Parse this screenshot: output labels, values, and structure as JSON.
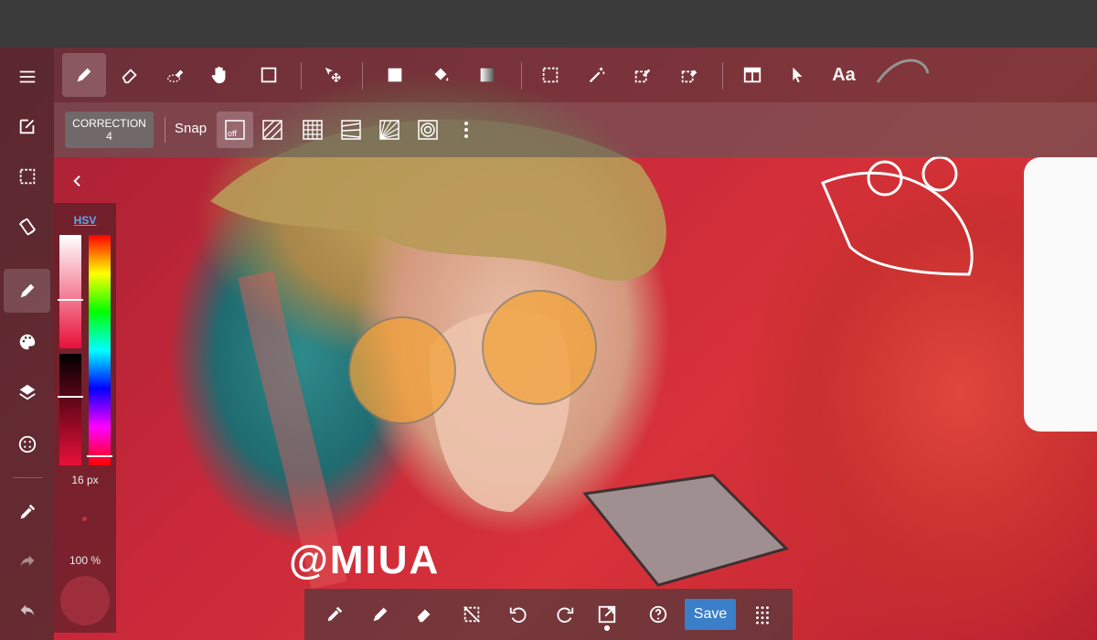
{
  "toolbar": {
    "text_tool_label": "Aa"
  },
  "snap_bar": {
    "correction_label": "CORRECTION",
    "correction_value": "4",
    "snap_label": "Snap",
    "snap_off_label": "off"
  },
  "color_panel": {
    "mode_label": "HSV",
    "brush_size": "16 px",
    "opacity": "100 %",
    "current_color": "#a63040"
  },
  "bottom_bar": {
    "save_label": "Save"
  },
  "artwork": {
    "signature": "@MIUA"
  },
  "colors": {
    "accent": "#3b7fc9"
  }
}
